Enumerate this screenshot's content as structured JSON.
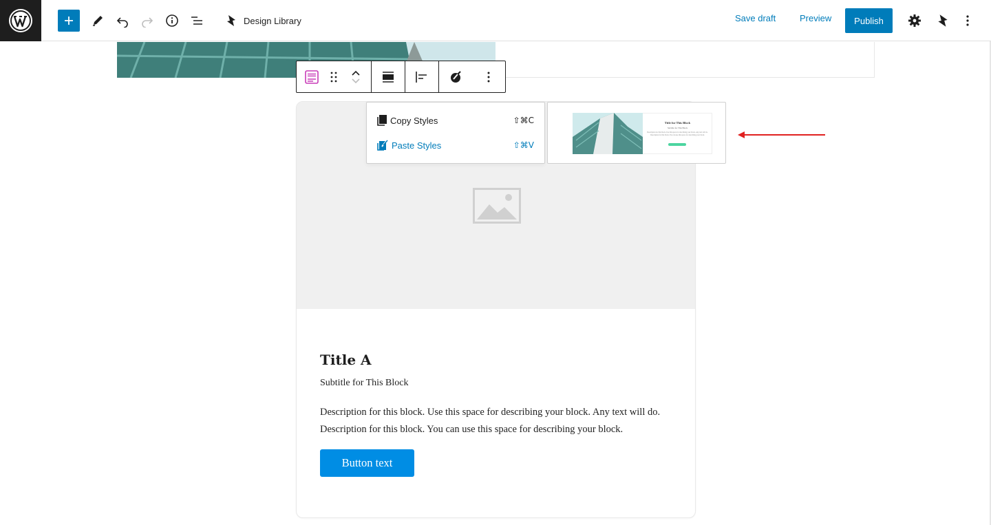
{
  "topbar": {
    "design_library_label": "Design Library",
    "save_draft_label": "Save draft",
    "preview_label": "Preview",
    "publish_label": "Publish"
  },
  "icons": {
    "wp": "wordpress-logo-icon",
    "add": "plus-icon",
    "tools": "pencil-icon",
    "undo": "undo-icon",
    "redo": "redo-icon",
    "details": "info-icon",
    "list_view": "list-view-icon",
    "settings": "gear-icon",
    "stackable": "stackable-logo-icon",
    "options": "more-vertical-icon"
  },
  "block_toolbar": {
    "items": [
      "card-block-icon",
      "drag-handle-icon",
      "move-up-icon",
      "move-down-icon",
      "align-full-icon",
      "align-left-icon",
      "paint-brush-icon",
      "more-vertical-icon"
    ]
  },
  "dropdown": {
    "copy_label": "Copy Styles",
    "copy_shortcut": "⇧⌘C",
    "paste_label": "Paste Styles",
    "paste_shortcut": "⇧⌘V"
  },
  "preview": {
    "title": "Title for This Block",
    "subtitle": "Subtitle for This Block",
    "description": "Description for this block. Use this space for describing your block. Any text will do. Description for this block. You can use this space for describing your block.",
    "button_color": "#4cd5a0"
  },
  "card": {
    "title": "Title A",
    "subtitle": "Subtitle for This Block",
    "description": "Description for this block. Use this space for describing your block. Any text will do. Description for this block. You can use this space for describing your block.",
    "button_label": "Button text",
    "button_color": "#008de4"
  },
  "colors": {
    "accent": "#007cba",
    "arrow": "#e0201f"
  }
}
